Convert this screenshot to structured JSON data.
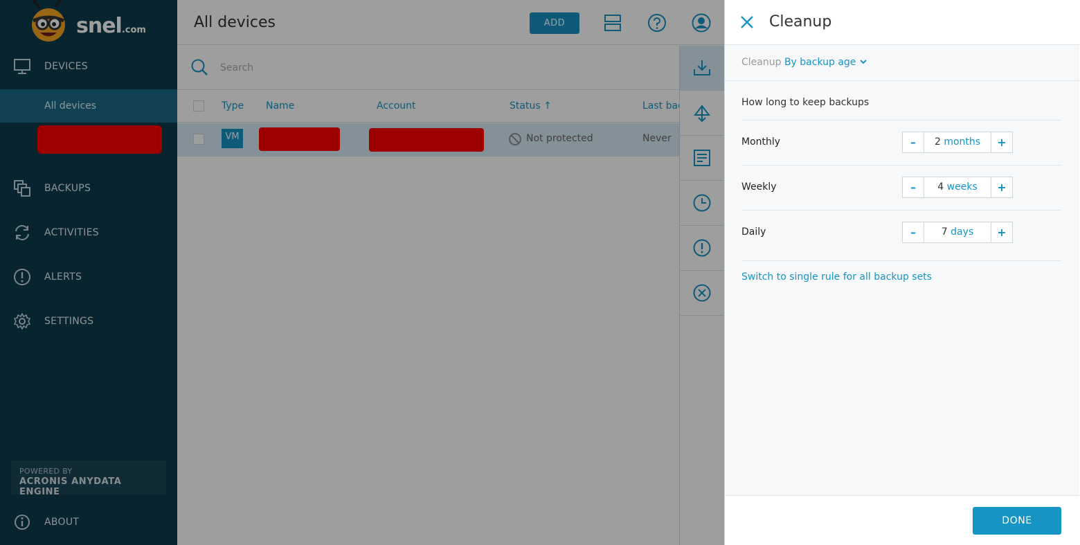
{
  "brand": {
    "logo_text": "snel",
    "logo_suffix": ".com",
    "mascot": "bee-mascot-icon"
  },
  "sidebar": {
    "sections": [
      {
        "label": "DEVICES",
        "icon": "monitor-icon"
      },
      {
        "label": "BACKUPS",
        "icon": "copies-icon"
      },
      {
        "label": "ACTIVITIES",
        "icon": "refresh-icon"
      },
      {
        "label": "ALERTS",
        "icon": "alert-icon"
      },
      {
        "label": "SETTINGS",
        "icon": "gear-icon"
      }
    ],
    "sub_item": "All devices",
    "powered_by": "POWERED BY",
    "engine": "ACRONIS ANYDATA ENGINE",
    "about": "ABOUT"
  },
  "main": {
    "title": "All devices",
    "add_label": "ADD",
    "search_placeholder": "Search",
    "columns": [
      "Type",
      "Name",
      "Account",
      "Status",
      "Last bac"
    ],
    "sort_indicator": "↑",
    "row": {
      "type": "VM",
      "status": "Not protected",
      "last_backup": "Never"
    },
    "rail_icons": [
      "download-icon",
      "deploy-icon",
      "list-icon",
      "clock-icon",
      "alert-icon",
      "cancel-icon"
    ]
  },
  "panel": {
    "title": "Cleanup",
    "mode_label": "Cleanup",
    "mode_value": "By backup age",
    "how_long": "How long to keep backups",
    "rules": [
      {
        "label": "Monthly",
        "value": "2",
        "unit": "months"
      },
      {
        "label": "Weekly",
        "value": "4",
        "unit": "weeks"
      },
      {
        "label": "Daily",
        "value": "7",
        "unit": "days"
      }
    ],
    "minus": "–",
    "plus": "+",
    "switch_link": "Switch to single rule for all backup sets",
    "done_label": "DONE"
  },
  "colors": {
    "sidebar": "#0d3a4c",
    "accent": "#1694c4",
    "sidebar_active": "#1b6b86"
  }
}
